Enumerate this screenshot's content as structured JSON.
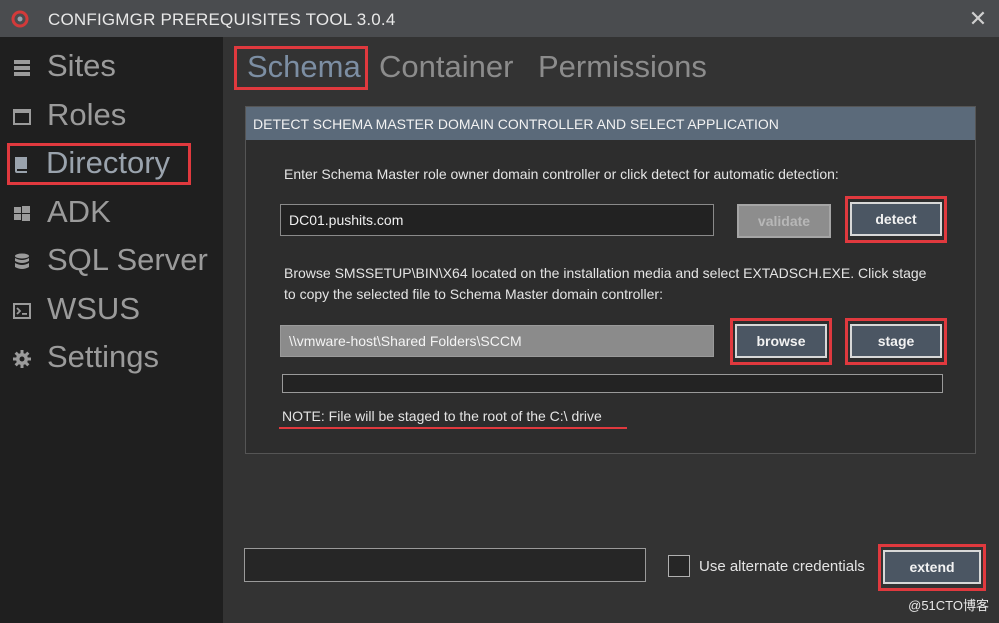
{
  "window": {
    "title": "CONFIGMGR PREREQUISITES TOOL 3.0.4",
    "close_glyph": "✕"
  },
  "sidebar": {
    "items": [
      {
        "label": "Sites",
        "icon": "database-icon"
      },
      {
        "label": "Roles",
        "icon": "window-icon"
      },
      {
        "label": "Directory",
        "icon": "book-icon",
        "active": true
      },
      {
        "label": "ADK",
        "icon": "windows-logo-icon"
      },
      {
        "label": "SQL Server",
        "icon": "database-stack-icon"
      },
      {
        "label": "WSUS",
        "icon": "terminal-icon"
      },
      {
        "label": "Settings",
        "icon": "gear-icon"
      }
    ]
  },
  "tabs": [
    {
      "label": "Schema",
      "active": true
    },
    {
      "label": "Container"
    },
    {
      "label": "Permissions"
    }
  ],
  "panel": {
    "header": "DETECT SCHEMA MASTER DOMAIN CONTROLLER AND SELECT APPLICATION",
    "instruction1": "Enter Schema Master role owner domain controller or click detect for automatic detection:",
    "dc_value": "DC01.pushits.com",
    "validate_label": "validate",
    "detect_label": "detect",
    "instruction2_line1": "Browse SMSSETUP\\BIN\\X64 located on the installation media and select EXTADSCH.EXE. Click stage",
    "instruction2_line2": "to copy the selected file to Schema Master domain controller:",
    "path_value": "\\\\vmware-host\\Shared Folders\\SCCM",
    "browse_label": "browse",
    "stage_label": "stage",
    "progress": 0,
    "note": "NOTE: File will be staged to the root of the C:\\ drive"
  },
  "footer": {
    "credentials_value": "",
    "checkbox_label": "Use alternate credentials",
    "checkbox_checked": false,
    "extend_label": "extend"
  },
  "watermark": "@51CTO博客",
  "colors": {
    "highlight": "#e0393e",
    "accent": "#5b6a7a",
    "button": "#4b5663"
  }
}
